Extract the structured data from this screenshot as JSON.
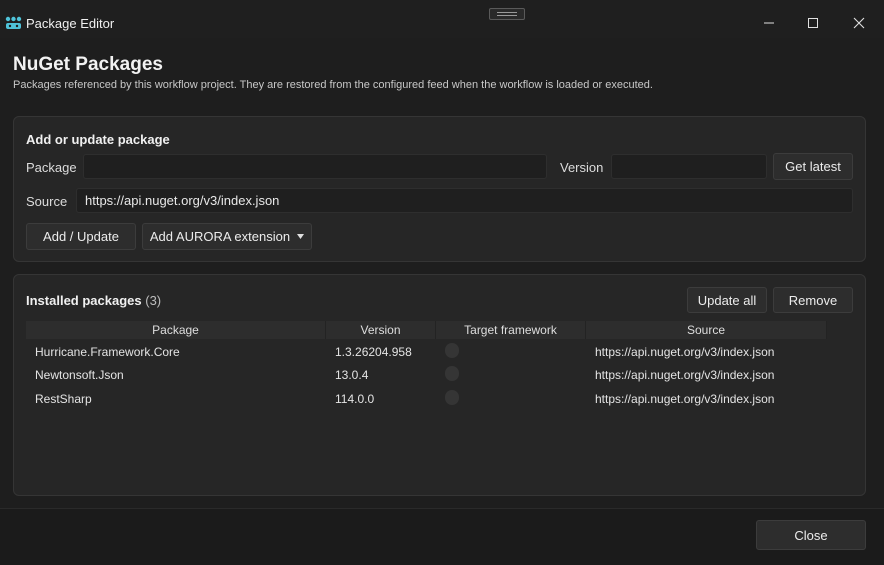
{
  "window": {
    "title": "Package Editor",
    "app_icon": "app-icon",
    "min_icon": "minimize-icon",
    "max_icon": "maximize-icon",
    "close_icon": "close-icon"
  },
  "header": {
    "title": "NuGet Packages",
    "subtitle": "Packages referenced by this workflow project. They are restored from the configured feed when the workflow is loaded or executed."
  },
  "add_panel": {
    "title": "Add or update package",
    "package_label": "Package",
    "package_value": "",
    "version_label": "Version",
    "version_value": "",
    "get_latest_label": "Get latest",
    "source_label": "Source",
    "source_value": "https://api.nuget.org/v3/index.json",
    "add_update_label": "Add / Update",
    "add_extension_label": "Add AURORA extension",
    "dropdown_icon": "caret-down-icon"
  },
  "installed": {
    "title": "Installed packages",
    "count": "(3)",
    "update_all_label": "Update all",
    "remove_label": "Remove",
    "columns": [
      "Package",
      "Version",
      "Target framework",
      "Source"
    ],
    "rows": [
      {
        "package": "Hurricane.Framework.Core",
        "version": "1.3.26204.958",
        "target_framework": "",
        "source": "https://api.nuget.org/v3/index.json"
      },
      {
        "package": "Newtonsoft.Json",
        "version": "13.0.4",
        "target_framework": "",
        "source": "https://api.nuget.org/v3/index.json"
      },
      {
        "package": "RestSharp",
        "version": "114.0.0",
        "target_framework": "",
        "source": "https://api.nuget.org/v3/index.json"
      }
    ]
  },
  "footer": {
    "close_label": "Close"
  },
  "colors": {
    "background": "#1e1e1e",
    "panel": "#262626",
    "button": "#2d2d2d",
    "accent_icon": "#4fc3d9"
  }
}
